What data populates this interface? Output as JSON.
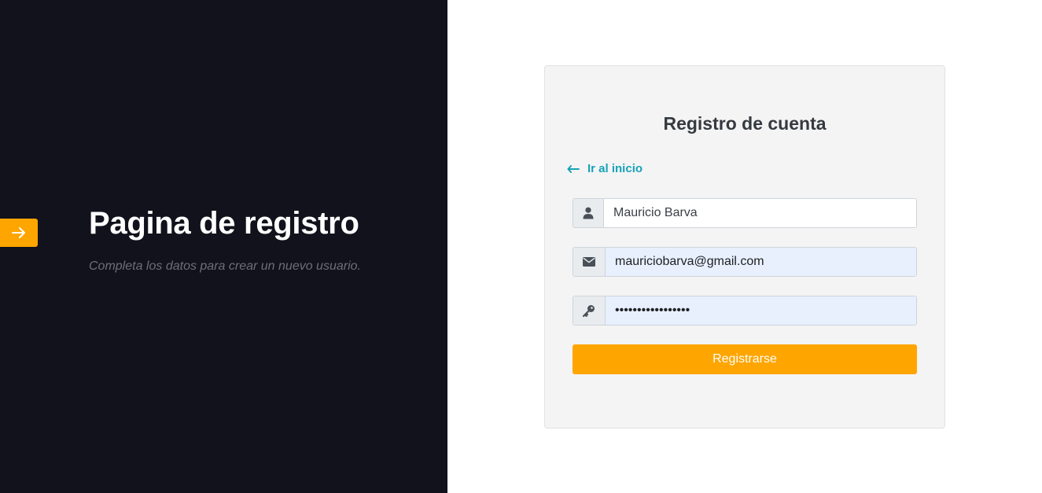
{
  "colors": {
    "left_panel_bg": "#12121c",
    "accent": "#ffa500",
    "link": "#17a2b8",
    "card_bg": "#f4f4f4",
    "autofill_bg": "#e8f0fe"
  },
  "hero": {
    "toggle_icon": "arrow-right-icon",
    "title": "Pagina de registro",
    "subtitle": "Completa los datos para crear un nuevo usuario."
  },
  "form": {
    "title": "Registro de cuenta",
    "back_link": {
      "icon": "arrow-left-icon",
      "label": "Ir al inicio"
    },
    "name": {
      "icon": "user-icon",
      "value": "Mauricio Barva"
    },
    "email": {
      "icon": "envelope-icon",
      "value": "mauriciobarva@gmail.com"
    },
    "password": {
      "icon": "key-icon",
      "value": "•••••••••••••••••"
    },
    "submit_label": "Registrarse"
  }
}
